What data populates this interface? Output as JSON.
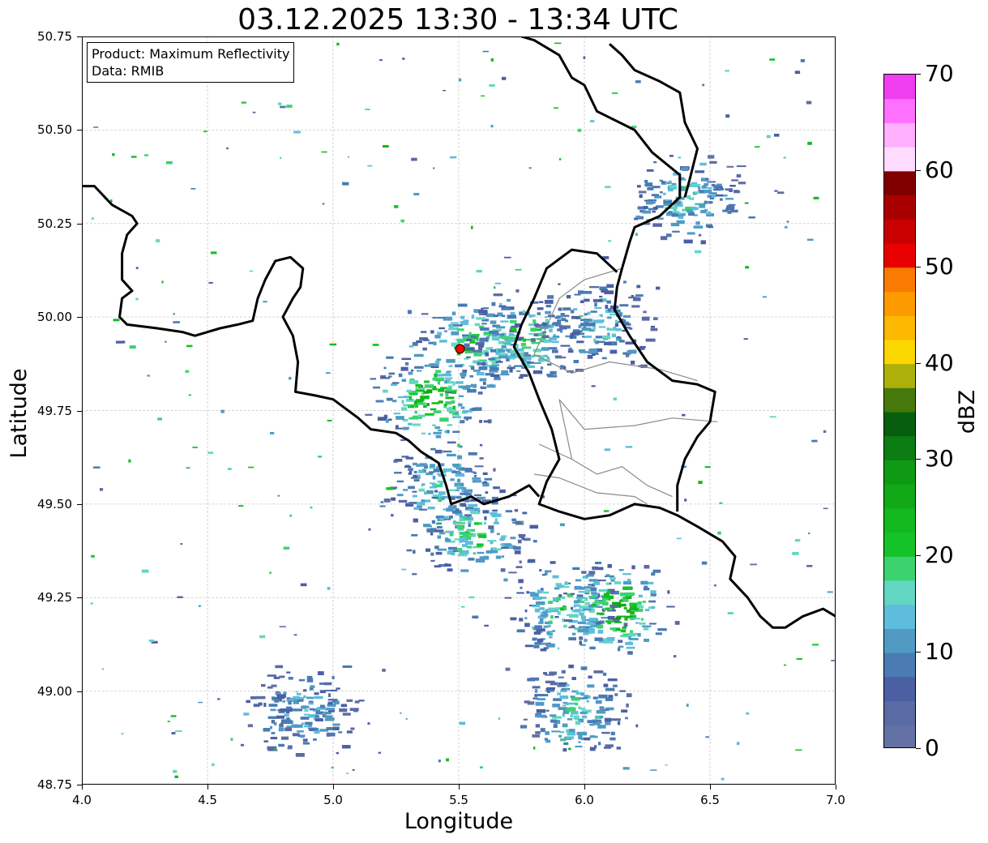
{
  "map": {
    "title": "03.12.2025 13:30 - 13:34 UTC",
    "xlabel": "Longitude",
    "ylabel": "Latitude",
    "xlim": [
      4.0,
      7.0
    ],
    "ylim": [
      48.75,
      50.75
    ],
    "xticks": [
      "4.0",
      "4.5",
      "5.0",
      "5.5",
      "6.0",
      "6.5",
      "7.0"
    ],
    "yticks": [
      "50.75",
      "50.50",
      "50.25",
      "50.00",
      "49.75",
      "49.50",
      "49.25",
      "49.00",
      "48.75"
    ],
    "grid": true,
    "info": {
      "product": "Product: Maximum Reflectivity",
      "source": "Data: RMIB"
    },
    "radar_site": {
      "lon": 5.505,
      "lat": 49.915,
      "color": "#ff0000"
    },
    "colorbar": {
      "label": "dBZ",
      "ticks": [
        "0",
        "10",
        "20",
        "30",
        "40",
        "50",
        "60",
        "70"
      ],
      "range": [
        0,
        70
      ],
      "colors": [
        "#6471a4",
        "#5a6aa5",
        "#4b5fa3",
        "#4a7bb3",
        "#509ac4",
        "#5ebddb",
        "#63d6c4",
        "#3cd26f",
        "#14c328",
        "#13b91e",
        "#11a917",
        "#0f9a14",
        "#0b7d13",
        "#075f0e",
        "#46780c",
        "#aeb00a",
        "#fcd600",
        "#fcb700",
        "#fc9a00",
        "#fb7a00",
        "#e80000",
        "#c80000",
        "#a80000",
        "#800000",
        "#ffdcff",
        "#ffb0ff",
        "#ff70ff",
        "#ef3ef0"
      ]
    }
  },
  "chart_data": {
    "type": "heatmap",
    "title": "03.12.2025 13:30 - 13:34 UTC",
    "xlabel": "Longitude",
    "ylabel": "Latitude",
    "xlim": [
      4.0,
      7.0
    ],
    "ylim": [
      48.75,
      50.75
    ],
    "units": "dBZ",
    "value_range": [
      0,
      70
    ],
    "echo_clusters": [
      {
        "lon": 5.55,
        "lat": 49.92,
        "dbz": 18
      },
      {
        "lon": 5.38,
        "lat": 49.78,
        "dbz": 22
      },
      {
        "lon": 5.42,
        "lat": 49.55,
        "dbz": 12
      },
      {
        "lon": 5.55,
        "lat": 49.42,
        "dbz": 16
      },
      {
        "lon": 5.92,
        "lat": 49.22,
        "dbz": 15
      },
      {
        "lon": 6.12,
        "lat": 49.22,
        "dbz": 22
      },
      {
        "lon": 5.95,
        "lat": 48.95,
        "dbz": 12
      },
      {
        "lon": 4.88,
        "lat": 48.95,
        "dbz": 8
      },
      {
        "lon": 5.75,
        "lat": 49.95,
        "dbz": 16
      },
      {
        "lon": 6.05,
        "lat": 49.98,
        "dbz": 10
      },
      {
        "lon": 6.4,
        "lat": 50.32,
        "dbz": 12
      }
    ]
  }
}
